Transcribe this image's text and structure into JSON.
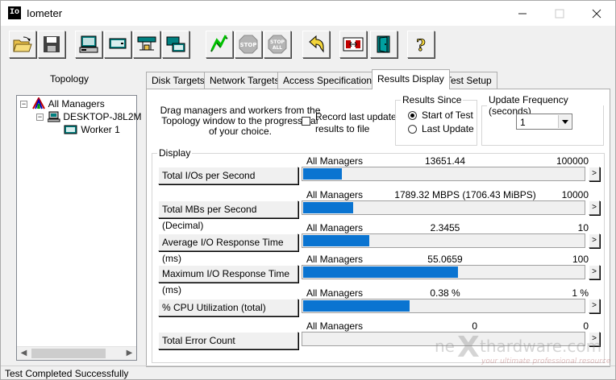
{
  "window": {
    "title": "Iometer",
    "app_icon": "Io"
  },
  "toolbar": {
    "buttons": [
      {
        "name": "open-icon"
      },
      {
        "name": "save-icon"
      },
      {
        "name": "new-disk-worker-icon"
      },
      {
        "name": "new-network-worker-icon"
      },
      {
        "name": "disconnect-icon"
      },
      {
        "name": "duplicate-worker-icon"
      },
      {
        "name": "start-test-icon"
      },
      {
        "name": "stop-icon",
        "label": "STOP"
      },
      {
        "name": "stop-all-icon",
        "label": "STOP ALL"
      },
      {
        "name": "reset-workers-icon"
      },
      {
        "name": "exit-icon"
      },
      {
        "name": "about-icon"
      }
    ]
  },
  "topology": {
    "title": "Topology",
    "items": [
      {
        "label": "All Managers"
      },
      {
        "label": "DESKTOP-J8L2M"
      },
      {
        "label": "Worker 1"
      }
    ]
  },
  "tabs": [
    {
      "label": "Disk Targets"
    },
    {
      "label": "Network Targets"
    },
    {
      "label": "Access Specifications"
    },
    {
      "label": "Results Display",
      "active": true
    },
    {
      "label": "Test Setup"
    }
  ],
  "results": {
    "hint": "Drag managers and workers from the Topology window to the progress bar of your choice.",
    "record_checkbox": "Record last update results to file",
    "results_since": {
      "title": "Results Since",
      "options": [
        "Start of Test",
        "Last Update"
      ],
      "selected": 0
    },
    "update_frequency": {
      "title": "Update Frequency (seconds)",
      "value": "1"
    },
    "display_title": "Display",
    "metrics": [
      {
        "label": "Total I/Os per Second",
        "source": "All Managers",
        "value": "13651.44",
        "max": "100000",
        "fill": 0.1365
      },
      {
        "label": "Total MBs per Second (Decimal)",
        "source": "All Managers",
        "value": "1789.32 MBPS (1706.43 MiBPS)",
        "max": "10000",
        "fill": 0.1789
      },
      {
        "label": "Average I/O Response Time (ms)",
        "source": "All Managers",
        "value": "2.3455",
        "max": "10",
        "fill": 0.2346
      },
      {
        "label": "Maximum I/O Response Time (ms)",
        "source": "All Managers",
        "value": "55.0659",
        "max": "100",
        "fill": 0.5507
      },
      {
        "label": "% CPU Utilization (total)",
        "source": "All Managers",
        "value": "0.38 %",
        "max": "1 %",
        "fill": 0.38
      },
      {
        "label": "Total Error Count",
        "source": "All Managers",
        "value": "0",
        "max": "0",
        "fill": 0
      }
    ]
  },
  "status": {
    "text": "Test Completed Successfully"
  },
  "watermark": {
    "brand": "nexthardware.com",
    "tagline": "your ultimate professional resource"
  },
  "colors": {
    "bar": "#0a74d1"
  }
}
